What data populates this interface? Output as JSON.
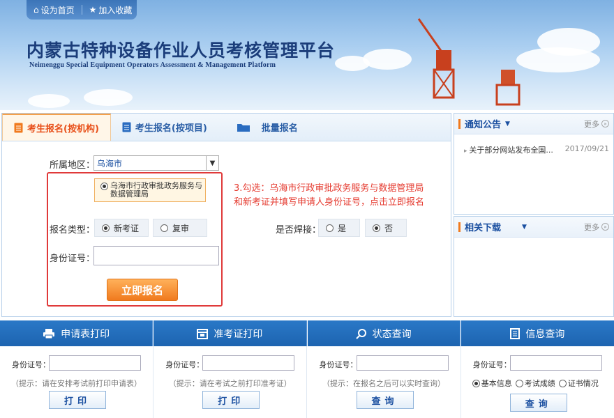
{
  "header": {
    "set_home": "设为首页",
    "add_favorite": "加入收藏",
    "title": "内蒙古特种设备作业人员考核管理平台",
    "subtitle": "Neimenggu Special Equipment Operators Assessment & Management Platform"
  },
  "tabs": [
    {
      "label": "考生报名(按机构)",
      "active": true
    },
    {
      "label": "考生报名(按项目)",
      "active": false
    },
    {
      "label": "批量报名",
      "active": false
    }
  ],
  "form": {
    "region_label": "所属地区：",
    "region_value": "乌海市",
    "org_option": "乌海市行政审批政务服务与数据管理局",
    "type_label": "报名类型：",
    "type_new": "新考证",
    "type_renew": "复审",
    "weld_label": "是否焊接：",
    "weld_yes": "是",
    "weld_no": "否",
    "id_label": "身份证号：",
    "id_value": "",
    "submit_label": "立即报名"
  },
  "annotation": {
    "line1": "3.勾选：乌海市行政审批政务服务与数据管理局",
    "line2": "和新考证并填写申请人身份证号，点击立即报名"
  },
  "notices": {
    "title": "通知公告",
    "more": "更多",
    "items": [
      {
        "text": "关于部分网站发布全国...",
        "date": "2017/09/21"
      }
    ]
  },
  "downloads": {
    "title": "相关下载",
    "more": "更多"
  },
  "bottom": [
    {
      "title": "申请表打印",
      "id_label": "身份证号：",
      "hint": "（提示：请在安排考试前打印申请表）",
      "button": "打印"
    },
    {
      "title": "准考证打印",
      "id_label": "身份证号：",
      "hint": "（提示：请在考试之前打印准考证）",
      "button": "打印"
    },
    {
      "title": "状态查询",
      "id_label": "身份证号：",
      "hint": "（提示：在报名之后可以实时查询）",
      "button": "查询"
    },
    {
      "title": "信息查询",
      "id_label": "身份证号：",
      "opt1": "基本信息",
      "opt2": "考试成绩",
      "opt3": "证书情况",
      "button": "查询"
    }
  ]
}
